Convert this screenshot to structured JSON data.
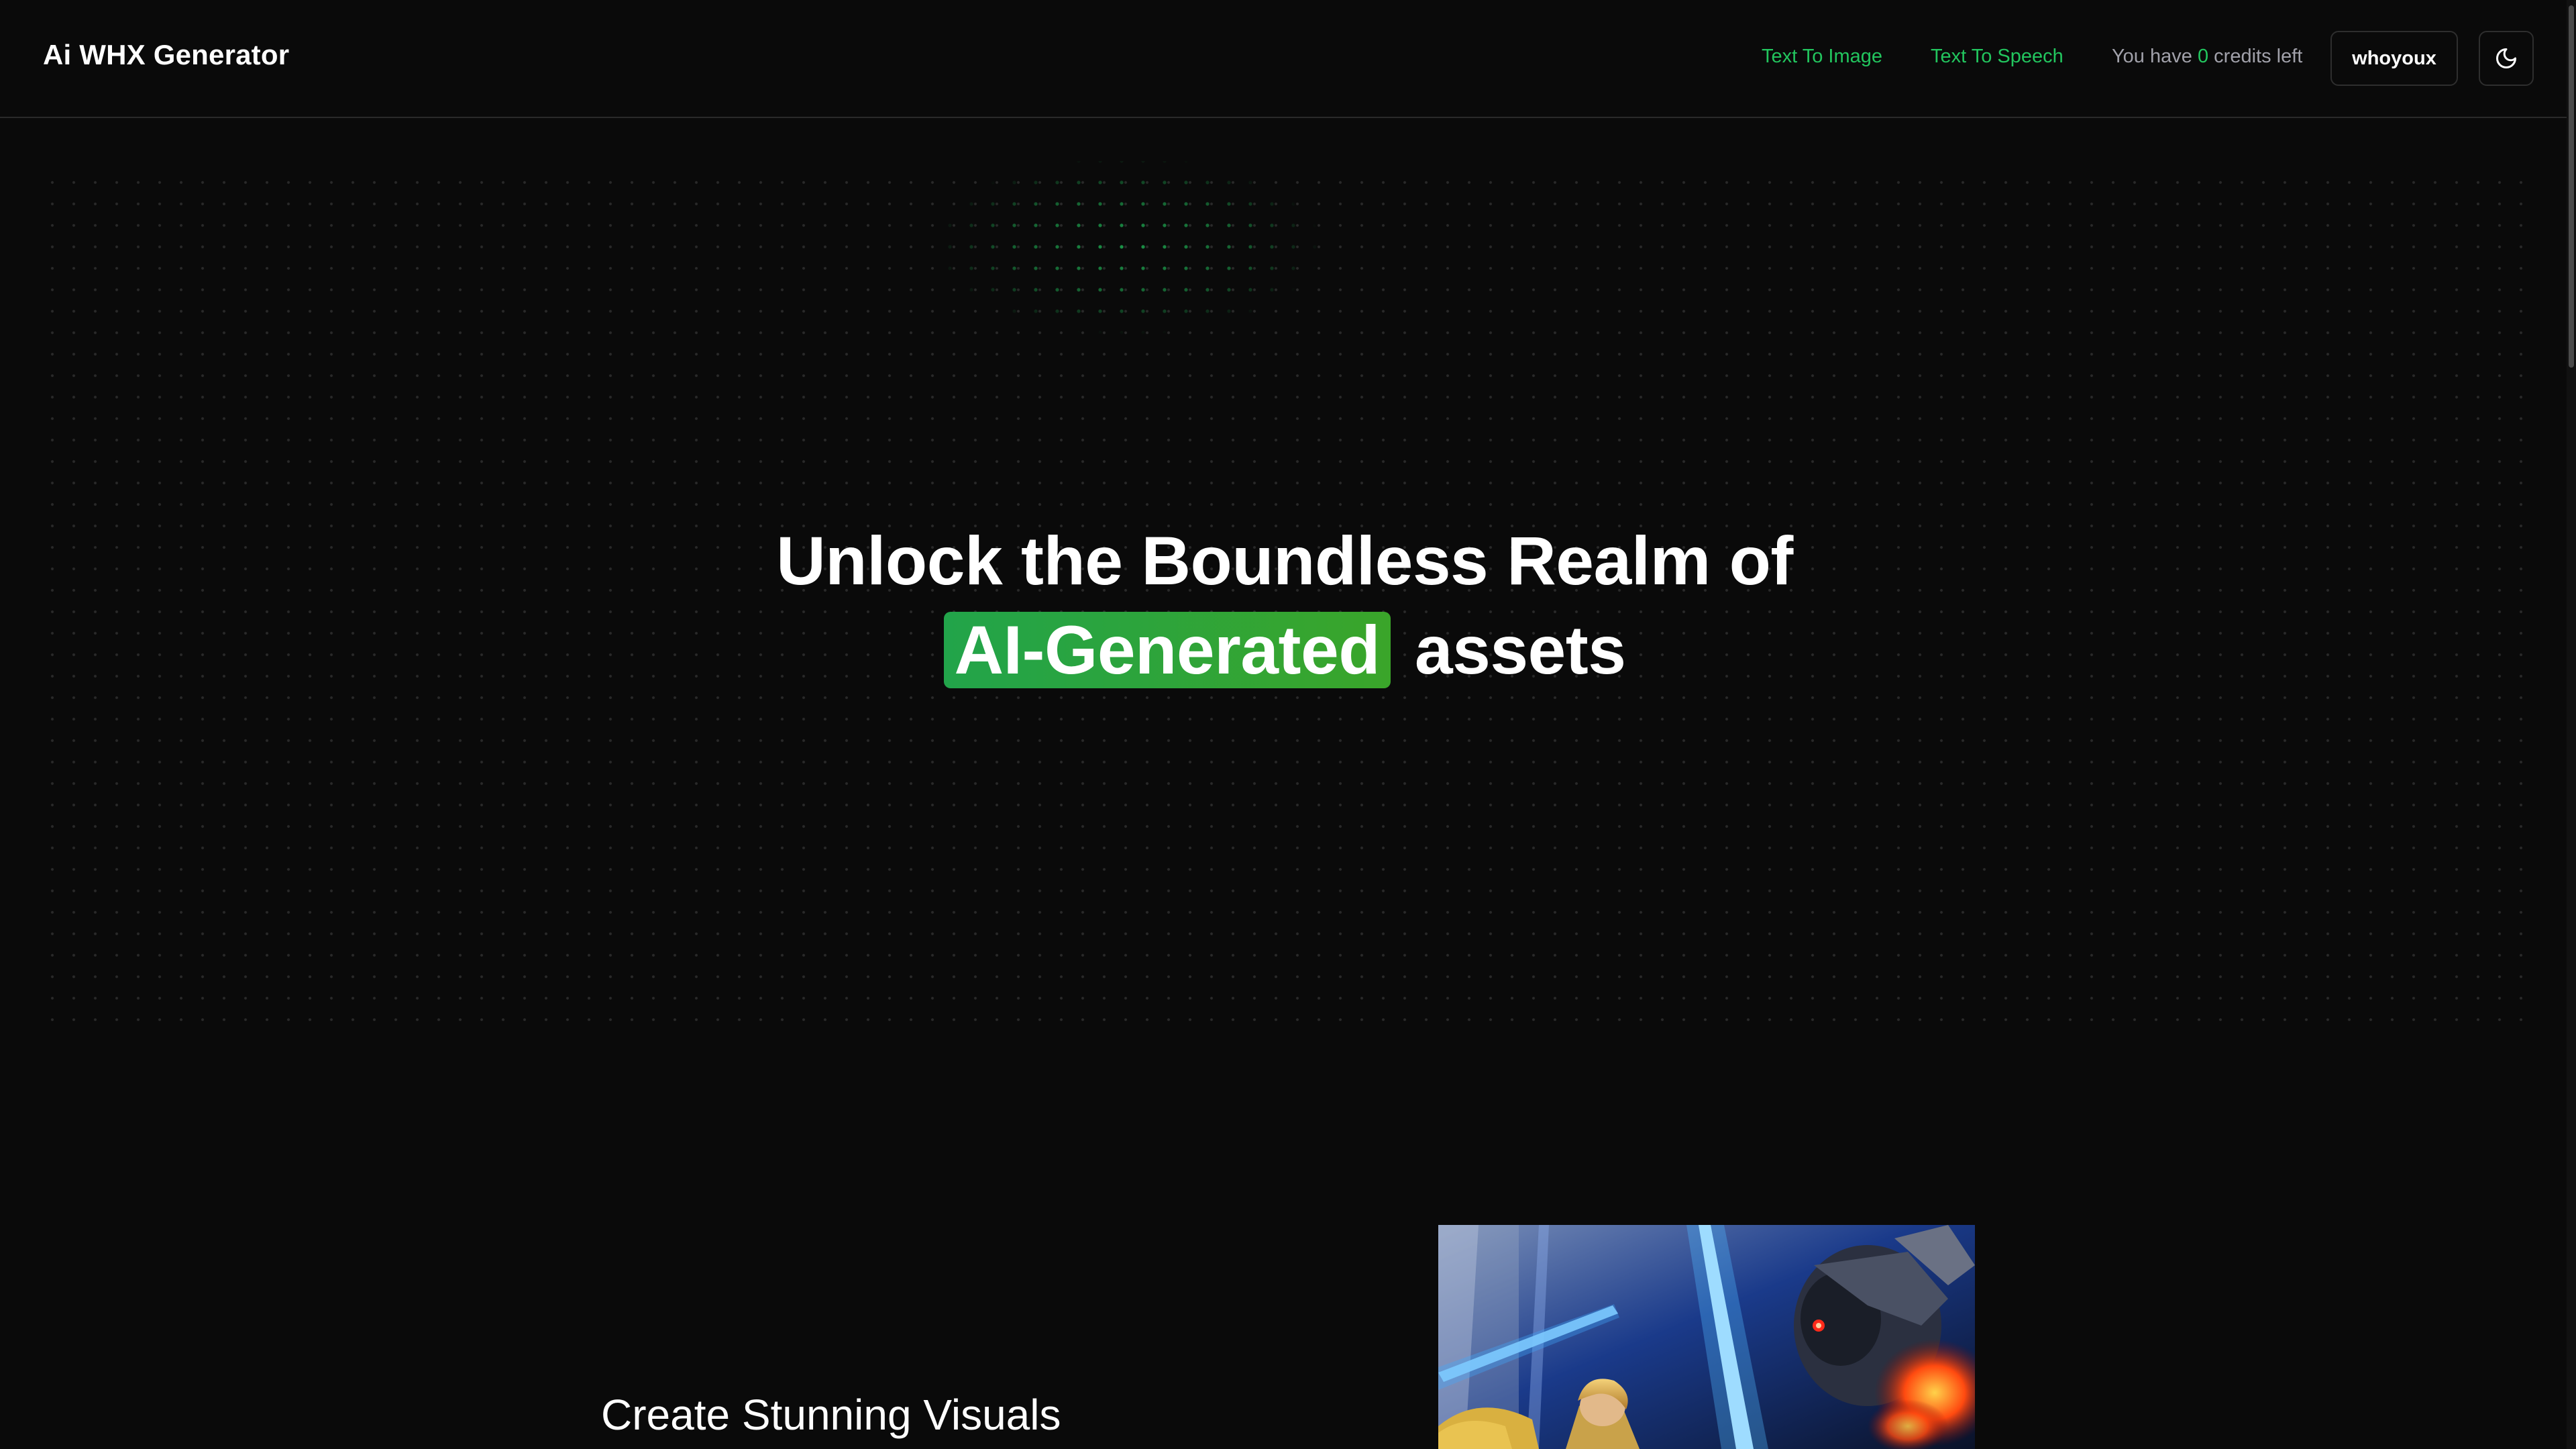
{
  "header": {
    "brand": "Ai WHX Generator",
    "nav": {
      "text_to_image": "Text To Image",
      "text_to_speech": "Text To Speech"
    },
    "credits": {
      "prefix": "You have",
      "count": "0",
      "suffix": "credits left"
    },
    "user_button": "whoyoux",
    "theme_toggle_icon": "moon-icon"
  },
  "hero": {
    "title_line1": "Unlock the Boundless Realm of",
    "title_highlight": "AI-Generated",
    "title_tail": "assets"
  },
  "feature": {
    "title": "Create Stunning Visuals",
    "image_icon": "ai-generated-artwork-image"
  },
  "colors": {
    "background": "#0a0a0a",
    "accent": "#22c55e",
    "highlight": "#2aa53f",
    "muted_text": "#a1a1aa"
  }
}
